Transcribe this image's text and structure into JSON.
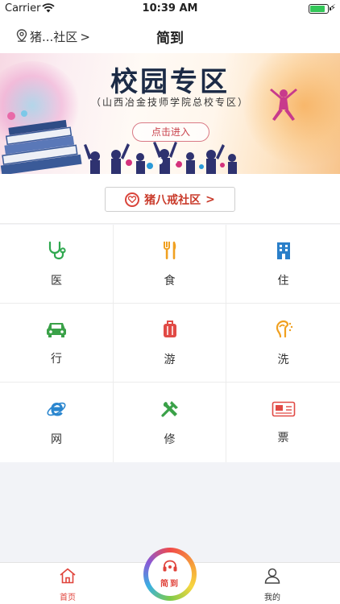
{
  "status_bar": {
    "carrier": "Carrier",
    "time": "10:39 AM",
    "battery_level": 0.9
  },
  "nav": {
    "location_text": "猪...社区",
    "location_chevron": ">",
    "title": "简到"
  },
  "banner": {
    "headline": "校园专区",
    "subline": "（山西冶金技师学院总校专区）",
    "enter_label": "点击进入",
    "page_count": 2,
    "active_page": 1
  },
  "community": {
    "label": "猪八戒社区",
    "chevron": ">"
  },
  "services": [
    {
      "label": "医",
      "icon": "stethoscope-icon",
      "color": "#2fa84f"
    },
    {
      "label": "食",
      "icon": "fork-knife-icon",
      "color": "#f0a020"
    },
    {
      "label": "住",
      "icon": "building-icon",
      "color": "#2a7fc9"
    },
    {
      "label": "行",
      "icon": "car-icon",
      "color": "#3aa148"
    },
    {
      "label": "游",
      "icon": "luggage-icon",
      "color": "#e14a45"
    },
    {
      "label": "洗",
      "icon": "laundry-icon",
      "color": "#f0a020"
    },
    {
      "label": "网",
      "icon": "internet-explorer-icon",
      "color": "#2a86cf"
    },
    {
      "label": "修",
      "icon": "tools-icon",
      "color": "#3aa148"
    },
    {
      "label": "票",
      "icon": "ticket-icon",
      "color": "#e14a45"
    }
  ],
  "tab_bar": {
    "home_label": "首页",
    "center_label": "简到",
    "me_label": "我的",
    "accent": "#e0433b"
  }
}
